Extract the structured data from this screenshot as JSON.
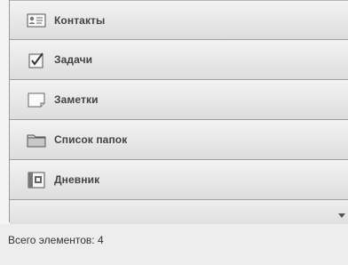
{
  "navigation": {
    "items": [
      {
        "label": "Контакты",
        "icon": "contacts-icon"
      },
      {
        "label": "Задачи",
        "icon": "tasks-icon"
      },
      {
        "label": "Заметки",
        "icon": "notes-icon"
      },
      {
        "label": "Список папок",
        "icon": "folder-list-icon"
      },
      {
        "label": "Дневник",
        "icon": "journal-icon"
      }
    ]
  },
  "status_bar": {
    "item_count_text": "Всего элементов: 4"
  }
}
